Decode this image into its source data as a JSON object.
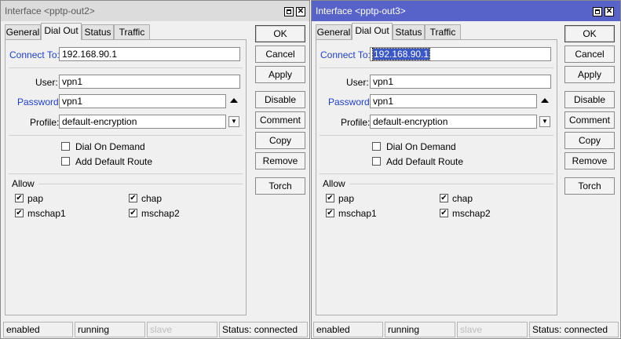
{
  "windows": [
    {
      "title": "Interface <pptp-out2>",
      "tabs": [
        "General",
        "Dial Out",
        "Status",
        "Traffic"
      ],
      "active_tab": "Dial Out",
      "connect_to_label": "Connect To:",
      "connect_to": "192.168.90.1",
      "user_label": "User:",
      "user": "vpn1",
      "password_label": "Password:",
      "password": "vpn1",
      "profile_label": "Profile:",
      "profile": "default-encryption",
      "dial_on_demand": "Dial On Demand",
      "add_default_route": "Add Default Route",
      "allow_label": "Allow",
      "allow": {
        "pap": "pap",
        "chap": "chap",
        "mschap1": "mschap1",
        "mschap2": "mschap2"
      },
      "buttons": {
        "ok": "OK",
        "cancel": "Cancel",
        "apply": "Apply",
        "disable": "Disable",
        "comment": "Comment",
        "copy": "Copy",
        "remove": "Remove",
        "torch": "Torch"
      },
      "status": {
        "enabled": "enabled",
        "running": "running",
        "slave": "slave",
        "connection": "Status: connected"
      }
    },
    {
      "title": "Interface <pptp-out3>",
      "tabs": [
        "General",
        "Dial Out",
        "Status",
        "Traffic"
      ],
      "active_tab": "Dial Out",
      "connect_to_label": "Connect To:",
      "connect_to": "192.168.90.1",
      "user_label": "User:",
      "user": "vpn1",
      "password_label": "Password:",
      "password": "vpn1",
      "profile_label": "Profile:",
      "profile": "default-encryption",
      "dial_on_demand": "Dial On Demand",
      "add_default_route": "Add Default Route",
      "allow_label": "Allow",
      "allow": {
        "pap": "pap",
        "chap": "chap",
        "mschap1": "mschap1",
        "mschap2": "mschap2"
      },
      "buttons": {
        "ok": "OK",
        "cancel": "Cancel",
        "apply": "Apply",
        "disable": "Disable",
        "comment": "Comment",
        "copy": "Copy",
        "remove": "Remove",
        "torch": "Torch"
      },
      "status": {
        "enabled": "enabled",
        "running": "running",
        "slave": "slave",
        "connection": "Status: connected"
      }
    }
  ],
  "icons": {
    "maximize": "maximize-icon",
    "close": "close-icon",
    "dropdown": "dropdown-arrow-icon",
    "collapse": "collapse-triangle-icon",
    "check": "checkmark-icon"
  },
  "colors": {
    "active_titlebar": "#5863c9",
    "inactive_titlebar": "#dcdcdc",
    "link_label": "#1e3fd0",
    "selection": "#3a57c8"
  }
}
